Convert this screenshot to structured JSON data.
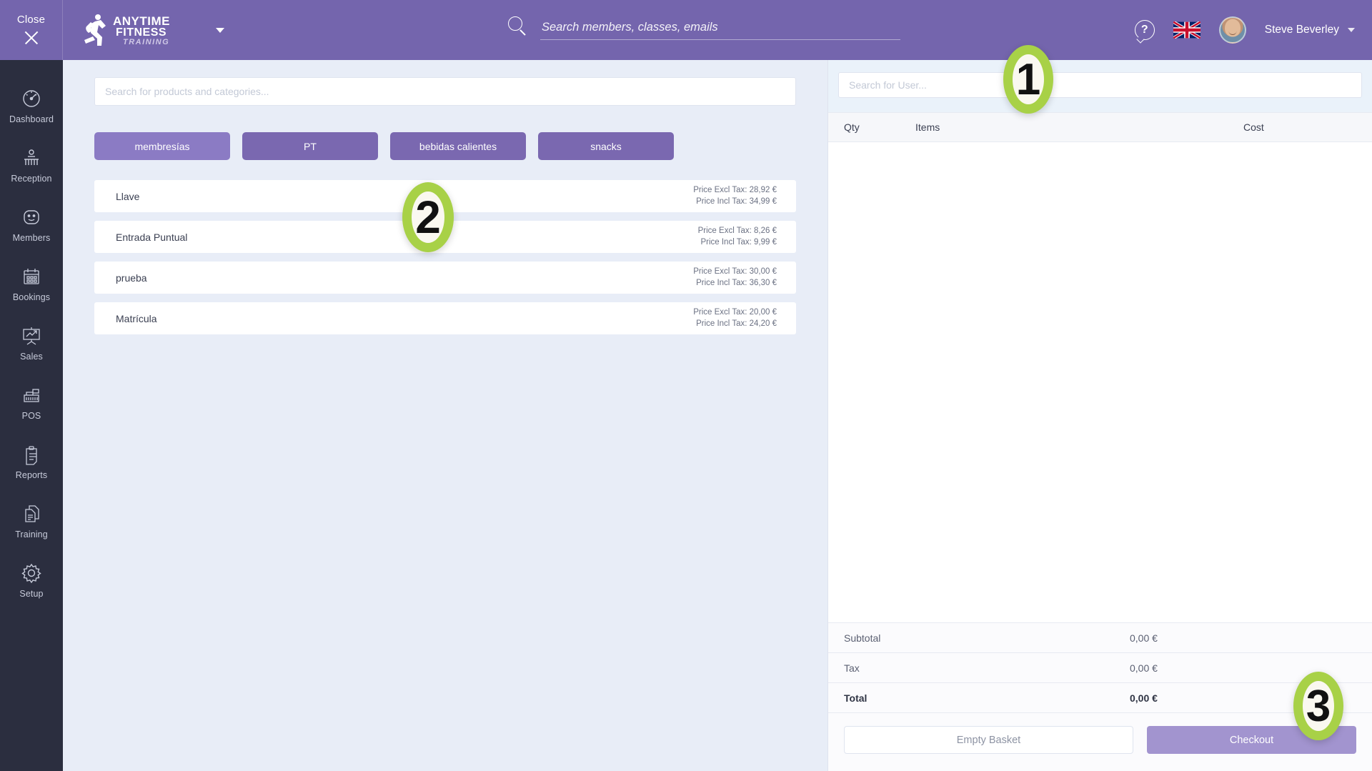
{
  "topbar": {
    "close_label": "Close",
    "brand_line1": "ANYTIME",
    "brand_line2": "FITNESS",
    "brand_line3": "TRAINING",
    "search_placeholder": "Search members, classes, emails",
    "search_value": "",
    "help_icon": "question-mark-bubble-icon",
    "flag_icon": "union-jack-flag-icon",
    "username": "Steve Beverley"
  },
  "sidebar": {
    "items": [
      {
        "label": "Dashboard",
        "icon": "speedometer-icon"
      },
      {
        "label": "Reception",
        "icon": "reception-desk-icon"
      },
      {
        "label": "Members",
        "icon": "smiley-face-icon"
      },
      {
        "label": "Bookings",
        "icon": "calendar-icon"
      },
      {
        "label": "Sales",
        "icon": "chart-easel-icon"
      },
      {
        "label": "POS",
        "icon": "cash-register-icon"
      },
      {
        "label": "Reports",
        "icon": "clipboard-icon"
      },
      {
        "label": "Training",
        "icon": "documents-icon"
      },
      {
        "label": "Setup",
        "icon": "gear-icon"
      }
    ]
  },
  "main": {
    "search_placeholder": "Search for products and categories...",
    "search_value": "",
    "categories": [
      {
        "label": "membresías",
        "active": true
      },
      {
        "label": "PT",
        "active": false
      },
      {
        "label": "bebidas calientes",
        "active": false
      },
      {
        "label": "snacks",
        "active": false
      }
    ],
    "products": [
      {
        "name": "Llave",
        "price_excl": "Price Excl Tax: 28,92 €",
        "price_incl": "Price Incl Tax: 34,99 €"
      },
      {
        "name": "Entrada Puntual",
        "price_excl": "Price Excl Tax: 8,26 €",
        "price_incl": "Price Incl Tax: 9,99 €"
      },
      {
        "name": "prueba",
        "price_excl": "Price Excl Tax: 30,00 €",
        "price_incl": "Price Incl Tax: 36,30 €"
      },
      {
        "name": "Matrícula",
        "price_excl": "Price Excl Tax: 20,00 €",
        "price_incl": "Price Incl Tax: 24,20 €"
      }
    ]
  },
  "basket": {
    "search_placeholder": "Search for User...",
    "search_value": "",
    "columns": {
      "qty": "Qty",
      "items": "Items",
      "cost": "Cost"
    },
    "rows": [],
    "totals": {
      "subtotal_label": "Subtotal",
      "subtotal_value": "0,00 €",
      "tax_label": "Tax",
      "tax_value": "0,00 €",
      "total_label": "Total",
      "total_value": "0,00 €"
    },
    "empty_basket_label": "Empty Basket",
    "checkout_label": "Checkout"
  },
  "callouts": {
    "one": "1",
    "two": "2",
    "three": "3"
  },
  "colors": {
    "header_purple": "#7465AD",
    "sidebar_dark": "#2B2E3F",
    "page_background": "#E8EDF7",
    "category_active": "#8B7BC4",
    "category_idle": "#7A68B0",
    "checkout_purple": "#A294CF",
    "callout_green": "#A8D147"
  }
}
